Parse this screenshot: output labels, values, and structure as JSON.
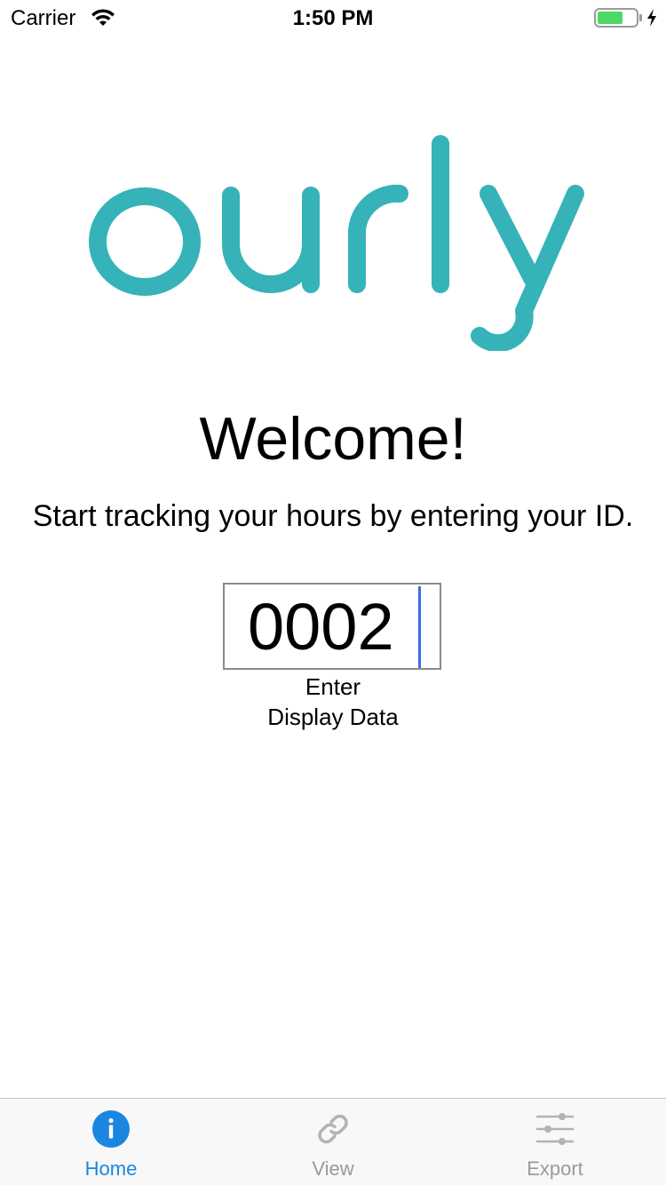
{
  "status_bar": {
    "carrier": "Carrier",
    "time": "1:50 PM"
  },
  "logo": {
    "text": "ourly",
    "color": "#35b3b8"
  },
  "main": {
    "welcome": "Welcome!",
    "subtitle": "Start tracking your hours by entering your ID.",
    "id_value": "0002",
    "enter_label": "Enter",
    "display_label": "Display Data"
  },
  "tab_bar": {
    "active_color": "#1a86e0",
    "inactive_color": "#9a9a9a",
    "tabs": [
      {
        "label": "Home",
        "icon": "info-icon",
        "active": true
      },
      {
        "label": "View",
        "icon": "link-icon",
        "active": false
      },
      {
        "label": "Export",
        "icon": "sliders-icon",
        "active": false
      }
    ]
  }
}
